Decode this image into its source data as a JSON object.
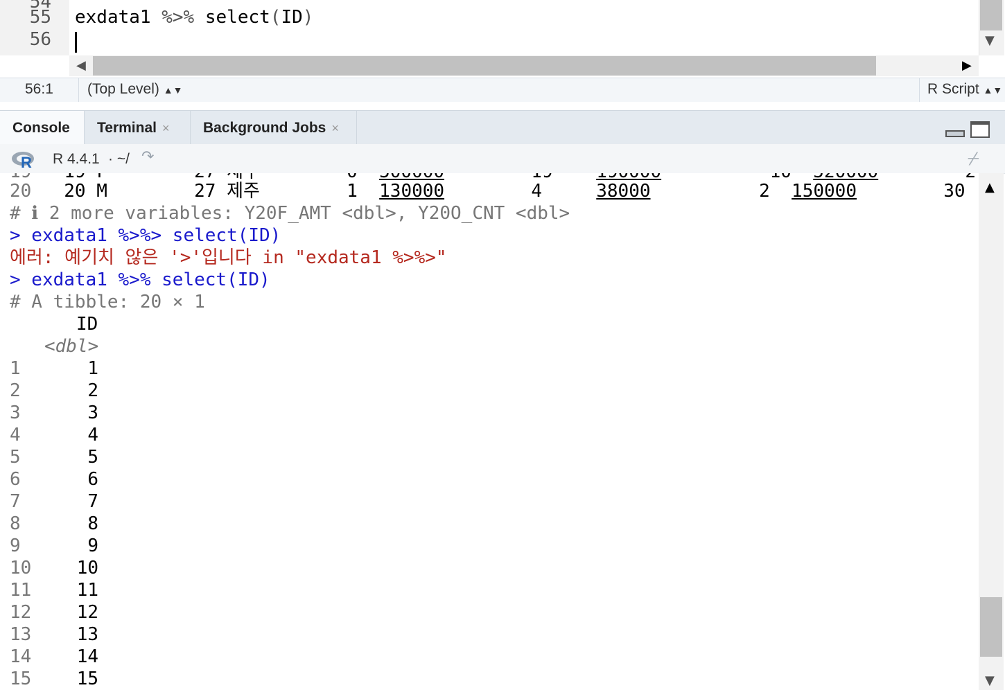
{
  "editor": {
    "lines": [
      {
        "num": "55",
        "code_obj": "exdata1",
        "code_pipe": "%>%",
        "code_fn": "select",
        "code_open": "(",
        "code_arg": "ID",
        "code_close": ")"
      },
      {
        "num": "56"
      }
    ]
  },
  "status": {
    "position": "56:1",
    "scope": "(Top Level)",
    "filetype": "R Script"
  },
  "tabs": [
    {
      "label": "Console"
    },
    {
      "label": "Terminal",
      "close": "×"
    },
    {
      "label": "Background Jobs",
      "close": "×"
    }
  ],
  "console_toolbar": {
    "version": "R 4.4.1",
    "path": "· ~/"
  },
  "console": {
    "row20": {
      "idx": "20",
      "id": "20",
      "sex": "M",
      "age": "27",
      "region": "제주",
      "c1": "1",
      "c2": "130000",
      "c3": "4",
      "c4": "38000",
      "c5": "2",
      "c6": "150000",
      "c7": "30"
    },
    "more_vars": "# ℹ 2 more variables: Y20F_AMT <dbl>, Y20O_CNT <dbl>",
    "cmd1": "> exdata1 %>%> select(ID)",
    "error": "에러: 예기치 않은 '>'입니다 in \"exdata1 %>%>\"",
    "cmd2": "> exdata1 %>% select(ID)",
    "tibble_header": "# A tibble: 20 × 1",
    "col_name": "ID",
    "col_type": "<dbl>",
    "rows": [
      {
        "i": "1",
        "v": "1"
      },
      {
        "i": "2",
        "v": "2"
      },
      {
        "i": "3",
        "v": "3"
      },
      {
        "i": "4",
        "v": "4"
      },
      {
        "i": "5",
        "v": "5"
      },
      {
        "i": "6",
        "v": "6"
      },
      {
        "i": "7",
        "v": "7"
      },
      {
        "i": "8",
        "v": "8"
      },
      {
        "i": "9",
        "v": "9"
      },
      {
        "i": "10",
        "v": "10"
      },
      {
        "i": "11",
        "v": "11"
      },
      {
        "i": "12",
        "v": "12"
      },
      {
        "i": "13",
        "v": "13"
      },
      {
        "i": "14",
        "v": "14"
      },
      {
        "i": "15",
        "v": "15"
      }
    ]
  }
}
